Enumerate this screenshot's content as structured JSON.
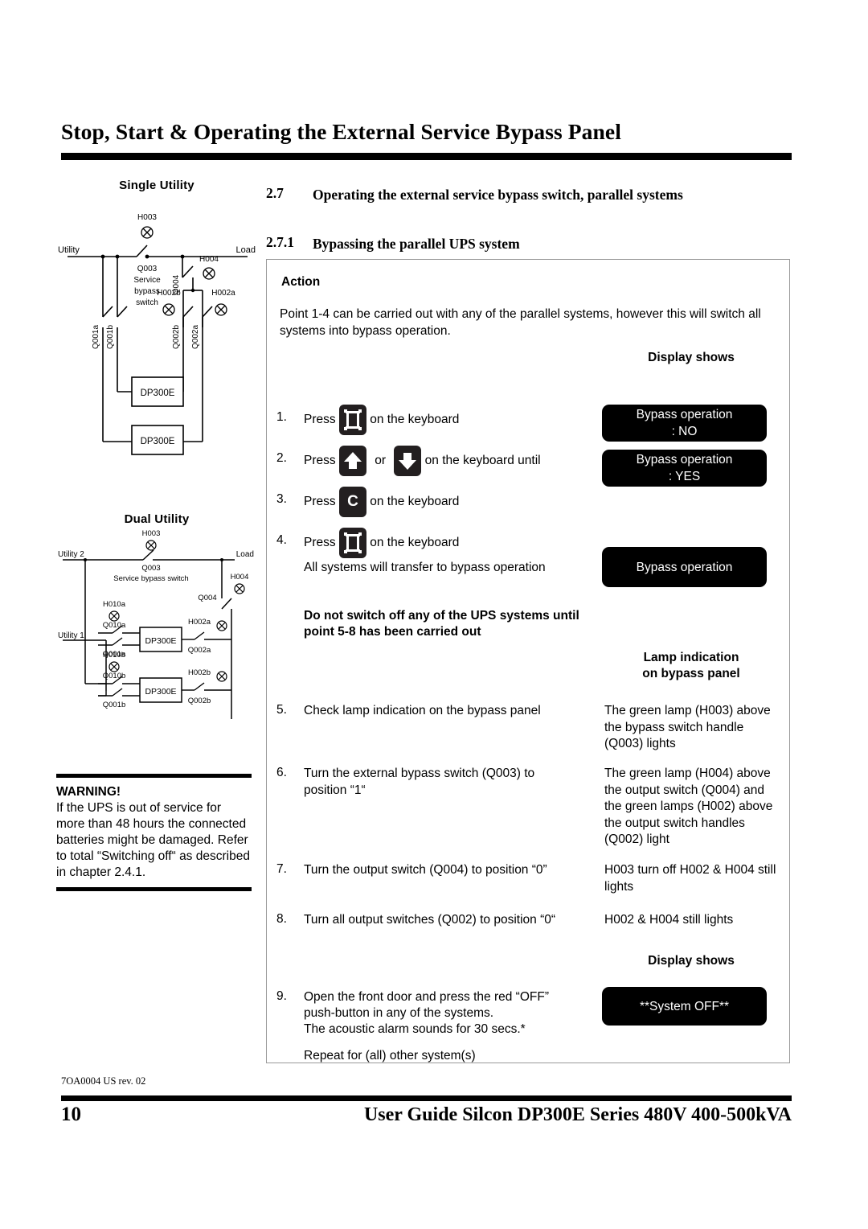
{
  "document": {
    "chapter_title": "Stop, Start & Operating the External Service Bypass Panel",
    "doc_code": "7OA0004 US rev. 02",
    "page_number": "10",
    "footer_title": "User Guide Silcon DP300E Series 480V 400-500kVA"
  },
  "sections": {
    "s27_num": "2.7",
    "s27_title": "Operating the external service bypass switch, parallel systems",
    "s271_num": "2.7.1",
    "s271_title": "Bypassing the parallel UPS system"
  },
  "diagrams": {
    "single": {
      "title": "Single Utility",
      "labels": {
        "utility": "Utility",
        "load": "Load",
        "h003": "H003",
        "q003": "Q003",
        "service": "Service",
        "bypass": "bypass",
        "switch": "switch",
        "h004": "H004",
        "q004": "Q004",
        "q001a": "Q001a",
        "q001b": "Q001b",
        "h002b": "H002b",
        "h002a": "H002a",
        "q002b": "Q002b",
        "q002a": "Q002a",
        "ups1": "DP300E",
        "ups2": "DP300E"
      }
    },
    "dual": {
      "title": "Dual Utility",
      "labels": {
        "utility2": "Utility 2",
        "utility1": "Utility 1",
        "load": "Load",
        "h003": "H003",
        "q003": "Q003",
        "service_bypass_switch": "Service bypass switch",
        "h004": "H004",
        "q004": "Q004",
        "h010a": "H010a",
        "q010a": "Q010a",
        "q001a": "Q001a",
        "h002a": "H002a",
        "q002a": "Q002a",
        "h010b": "H010b",
        "q010b": "Q010b",
        "q001b": "Q001b",
        "h002b": "H002b",
        "q002b": "Q002b",
        "ups1": "DP300E",
        "ups2": "DP300E"
      }
    }
  },
  "warning": {
    "title": "WARNING!",
    "text": "If the UPS is out of service for more than 48 hours the connected batteries might be damaged. Refer to total “Switching off“ as described in chapter 2.4.1."
  },
  "panel": {
    "action_heading": "Action",
    "intro": "Point 1-4 can be carried out with any of the parallel systems, however this will switch all systems into bypass operation.",
    "display_shows_1": "Display shows",
    "steps_1_4": [
      {
        "num": "1.",
        "pre": "Press",
        "key": "menu-key",
        "post": "on the keyboard"
      },
      {
        "num": "2.",
        "pre": "Press",
        "key": "up-arrow-key",
        "mid": "or",
        "key2": "down-arrow-key",
        "post": "on the keyboard until"
      },
      {
        "num": "3.",
        "pre": "Press",
        "key": "c-key",
        "key_letter": "C",
        "post": "on the keyboard"
      },
      {
        "num": "4.",
        "pre": "Press",
        "key": "menu-key",
        "post": "on the keyboard"
      }
    ],
    "lcd_bypass_no": "Bypass operation : NO",
    "lcd_bypass_no_l1": "Bypass operation",
    "lcd_bypass_no_l2": ": NO",
    "lcd_bypass_yes_l1": "Bypass operation",
    "lcd_bypass_yes_l2": ": YES",
    "transfer_note": "All systems will transfer to bypass operation",
    "lcd_bypass_operation": "Bypass operation",
    "caution_l1": "Do not switch off any of the UPS systems until",
    "caution_l2": "point 5-8 has been carried out",
    "lamp_heading_l1": "Lamp indication",
    "lamp_heading_l2": "on bypass panel",
    "steps_5_8": [
      {
        "num": "5.",
        "action": "Check lamp indication on the bypass panel",
        "result": "The green lamp (H003) above the bypass switch handle (Q003) lights"
      },
      {
        "num": "6.",
        "action": "Turn the external bypass switch (Q003) to position “1“",
        "result": "The green lamp (H004) above the output switch (Q004) and the green lamps (H002) above the output switch handles (Q002) light"
      },
      {
        "num": "7.",
        "action": "Turn the output switch (Q004) to position “0”",
        "result": "H003 turn off H002 & H004 still lights"
      },
      {
        "num": "8.",
        "action": "Turn all output switches (Q002) to position “0“",
        "result": "H002 & H004 still lights"
      }
    ],
    "display_shows_2": "Display shows",
    "step9": {
      "num": "9.",
      "line1": "Open the front door and press the red “OFF”",
      "line2": "push-button in any of the systems.",
      "line3": "The acoustic alarm sounds for 30 secs.*",
      "line4": "Repeat for (all) other system(s)"
    },
    "lcd_system_off": "**System OFF**"
  },
  "colors": {
    "ink": "#000000",
    "lcd_bg": "#000000",
    "lcd_text": "#ffffff",
    "panel_border": "#9a9a9a",
    "key_bg": "#231f20"
  }
}
